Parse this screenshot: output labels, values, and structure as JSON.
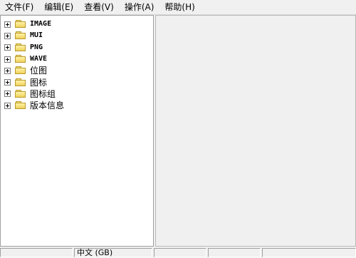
{
  "menubar": {
    "items": [
      "文件(F)",
      "编辑(E)",
      "查看(V)",
      "操作(A)",
      "帮助(H)"
    ]
  },
  "tree": {
    "items": [
      {
        "label": "IMAGE"
      },
      {
        "label": "MUI"
      },
      {
        "label": "PNG"
      },
      {
        "label": "WAVE"
      },
      {
        "label": "位图"
      },
      {
        "label": "图标"
      },
      {
        "label": "图标组"
      },
      {
        "label": "版本信息"
      }
    ]
  },
  "statusbar": {
    "encoding": "中文 (GB)"
  }
}
